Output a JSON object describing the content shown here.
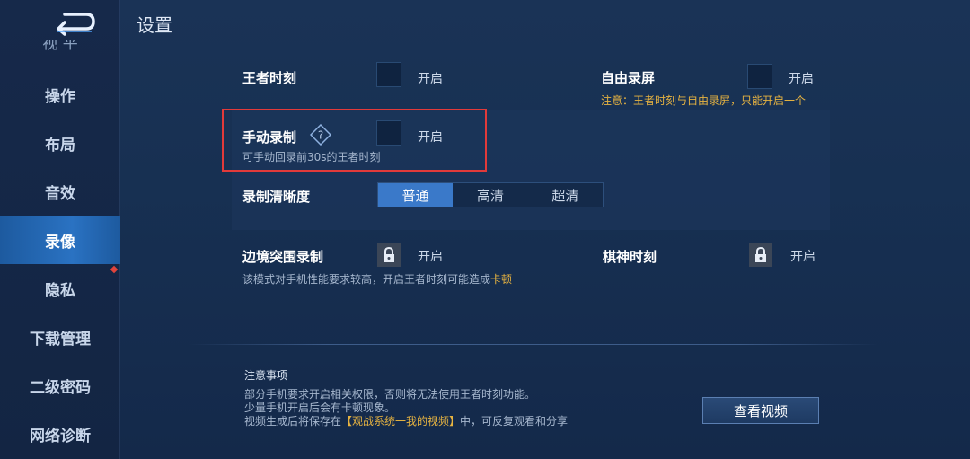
{
  "header": {
    "title": "设置",
    "back_icon": "back-arrow-icon"
  },
  "sidebar": {
    "partial_label": "视 平",
    "items": [
      {
        "label": "操作"
      },
      {
        "label": "布局"
      },
      {
        "label": "音效"
      },
      {
        "label": "录像",
        "active": true
      },
      {
        "label": "隐私",
        "badge": "red-dot"
      },
      {
        "label": "下载管理"
      },
      {
        "label": "二级密码"
      },
      {
        "label": "网络诊断"
      }
    ]
  },
  "settings": {
    "king_moment": {
      "label": "王者时刻",
      "on_text": "开启",
      "checked": false
    },
    "free_record": {
      "label": "自由录屏",
      "on_text": "开启",
      "checked": false,
      "notice_prefix": "注意：",
      "notice_mid": "王者时刻与自由录屏，",
      "notice_hl": "只能开启一个"
    },
    "manual_record": {
      "label": "手动录制",
      "on_text": "开启",
      "checked": false,
      "hint": "可手动回录前30s的王者时刻",
      "help_icon": "question-diamond-icon"
    },
    "quality": {
      "label": "录制清晰度",
      "options": [
        "普通",
        "高清",
        "超清"
      ],
      "selected": "普通"
    },
    "border_record": {
      "label": "边境突围录制",
      "on_text": "开启",
      "locked": true,
      "hint_prefix": "该模式对手机性能要求较高，开启王者时刻可能造成",
      "hint_hl": "卡顿"
    },
    "chess_moment": {
      "label": "棋神时刻",
      "on_text": "开启",
      "locked": true
    }
  },
  "notes": {
    "title": "注意事项",
    "line1": "部分手机要求开启相关权限，否则将无法使用王者时刻功能。",
    "line2": "少量手机开启后会有卡顿现象。",
    "line3_prefix": "视频生成后将保存在",
    "line3_hl": "【观战系统一我的视频】",
    "line3_suffix": "中，可反复观看和分享"
  },
  "actions": {
    "view_video": "查看视频"
  },
  "colors": {
    "accent": "#3a79c9",
    "warning": "#e6b341",
    "highlight_frame": "#e23a3a"
  }
}
